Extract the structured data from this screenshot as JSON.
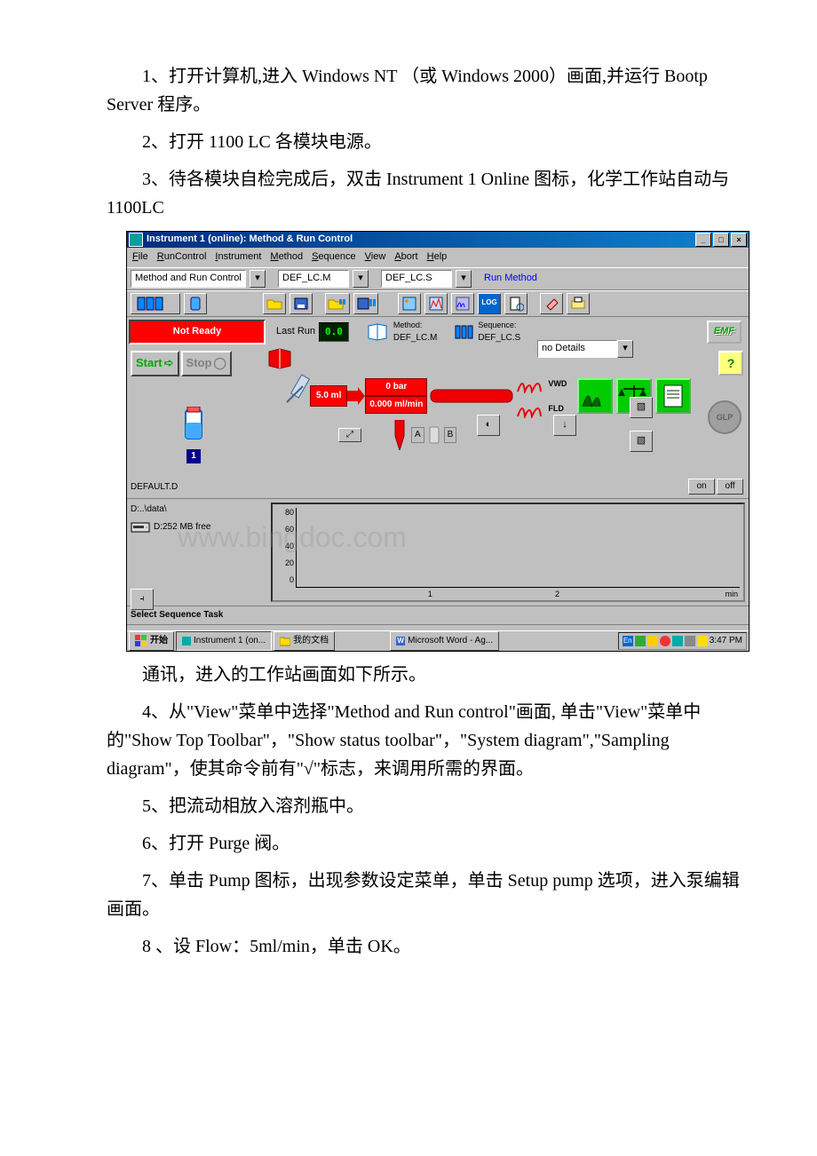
{
  "doc": {
    "p1": "1、打开计算机,进入 Windows NT （或 Windows 2000）画面,并运行 Bootp Server 程序。",
    "p2": "2、打开 1100 LC 各模块电源。",
    "p3": "3、待各模块自检完成后，双击 Instrument 1 Online 图标，化学工作站自动与 1100LC",
    "p_after_img": "通讯，进入的工作站画面如下所示。",
    "p4": "4、从\"View\"菜单中选择\"Method and Run control\"画面, 单击\"View\"菜单中的\"Show Top Toolbar\"，\"Show status toolbar\"，\"System diagram\",\"Sampling diagram\"，使其命令前有\"√\"标志，来调用所需的界面。",
    "p5": "5、把流动相放入溶剂瓶中。",
    "p6": "6、打开 Purge 阀。",
    "p7": "7、单击 Pump 图标，出现参数设定菜单，单击 Setup pump 选项，进入泵编辑画面。",
    "p8": "8 、设 Flow：5ml/min，单击 OK。"
  },
  "app": {
    "title": "Instrument 1 (online): Method & Run Control",
    "menu": {
      "file": "File",
      "runctrl": "RunControl",
      "instr": "Instrument",
      "method": "Method",
      "seq": "Sequence",
      "view": "View",
      "abort": "Abort",
      "help": "Help"
    },
    "view_selector": "Method and Run Control",
    "method_file": "DEF_LC.M",
    "seq_file": "DEF_LC.S",
    "run_method": "Run Method",
    "status": "Not Ready",
    "lastrun_label": "Last Run",
    "lastrun_value": "0.0",
    "method_label": "Method:",
    "method_name": "DEF_LC.M",
    "seq_label": "Sequence:",
    "seq_name": "DEF_LC.S",
    "emf": "EMF",
    "start": "Start",
    "stop": "Stop",
    "help": "?",
    "glp": "GLP",
    "on": "on",
    "off": "off",
    "vial_num": "1",
    "pump_flow": "5.0 ml",
    "pump_label1": "0 bar",
    "pump_label2": "0.000 ml/min",
    "injector_a": "A",
    "injector_b": "B",
    "vwd": "VWD",
    "fld": "FLD",
    "default_d": "DEFAULT.D",
    "drive_path": "D:..\\data\\",
    "disk_free": "D:252 MB free",
    "details": "no Details",
    "y_ticks": [
      "80",
      "60",
      "40",
      "20",
      "0"
    ],
    "x_ticks": {
      "t1": "1",
      "t2": "2",
      "unit": "min"
    },
    "seltask": "Select Sequence Task",
    "taskbar": {
      "start": "开始",
      "task1": "Instrument 1 (on...",
      "task2": "我的文档",
      "task3": "Microsoft Word - Ag...",
      "lang": "En",
      "time": "3:47 PM"
    }
  },
  "watermark": "www.bingdoc.com"
}
